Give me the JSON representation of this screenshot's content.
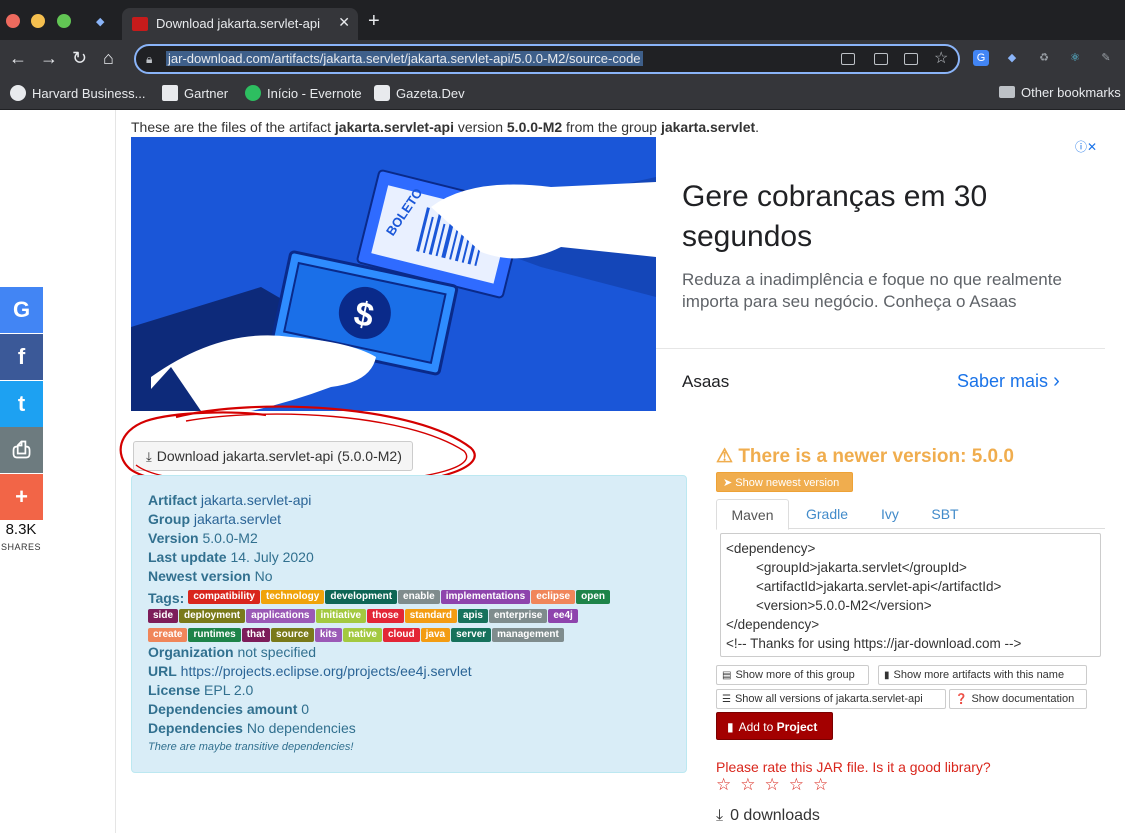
{
  "browser": {
    "tab_title": "Download jakarta.servlet-api",
    "tab_close": "✕",
    "new_tab": "+",
    "url": "jar-download.com/artifacts/jakarta.servlet/jakarta.servlet-api/5.0.0-M2/source-code",
    "bookmarks": [
      {
        "label": "Harvard Business...",
        "icon": "globe-icon"
      },
      {
        "label": "Gartner",
        "icon": "gartner-icon"
      },
      {
        "label": "Início - Evernote",
        "icon": "evernote-icon"
      },
      {
        "label": "Gazeta.Dev",
        "icon": "gazeta-icon"
      }
    ],
    "other_bookmarks": "Other bookmarks"
  },
  "share": {
    "count": "8.3K",
    "label": "SHARES",
    "buttons": [
      {
        "icon": "google-icon",
        "glyph": "G",
        "color": "#4285f4"
      },
      {
        "icon": "facebook-icon",
        "glyph": "f",
        "color": "#3b5998"
      },
      {
        "icon": "twitter-icon",
        "glyph": "t",
        "color": "#1da1f2"
      },
      {
        "icon": "print-icon",
        "glyph": "⎙",
        "color": "#6d7b7f"
      },
      {
        "icon": "plus-icon",
        "glyph": "+",
        "color": "#f26547"
      }
    ]
  },
  "intro": {
    "prefix": "These are the files of the artifact ",
    "artifact": "jakarta.servlet-api",
    "mid1": " version ",
    "version": "5.0.0-M2",
    "mid2": " from the group ",
    "group": "jakarta.servlet",
    "suffix": "."
  },
  "ad": {
    "headline": "Gere cobranças em 30 segundos",
    "body": "Reduza a inadimplência e foque no que realmente importa para seu negócio. Conheça o Asaas",
    "brand": "Asaas",
    "cta": "Saber mais",
    "ticket_text": "BOLETO",
    "info_icon": "ⓘ✕"
  },
  "download_button": "Download jakarta.servlet-api (5.0.0-M2)",
  "info": {
    "artifact": {
      "key": "Artifact",
      "value": "jakarta.servlet-api"
    },
    "group": {
      "key": "Group",
      "value": "jakarta.servlet"
    },
    "version": {
      "key": "Version",
      "value": "5.0.0-M2"
    },
    "last_update": {
      "key": "Last update",
      "value": "14. July 2020"
    },
    "newest_version": {
      "key": "Newest version",
      "value": "No"
    },
    "tags_key": "Tags:",
    "organization": {
      "key": "Organization",
      "value": "not specified"
    },
    "url": {
      "key": "URL",
      "value": "https://projects.eclipse.org/projects/ee4j.servlet"
    },
    "license": {
      "key": "License",
      "value": "EPL 2.0"
    },
    "dependencies_amount": {
      "key": "Dependencies amount",
      "value": "0"
    },
    "dependencies": {
      "key": "Dependencies",
      "value": "No dependencies"
    },
    "transitive_note": "There are maybe transitive dependencies!"
  },
  "tags": [
    [
      {
        "label": "compatibility",
        "color": "#d9261c"
      },
      {
        "label": "technology",
        "color": "#f0a30a"
      },
      {
        "label": "development",
        "color": "#0e6655"
      },
      {
        "label": "enable",
        "color": "#7f8c8d"
      },
      {
        "label": "implementations",
        "color": "#8e44ad"
      },
      {
        "label": "eclipse",
        "color": "#f0865a"
      },
      {
        "label": "open",
        "color": "#1e8449"
      }
    ],
    [
      {
        "label": "side",
        "color": "#7d1d5a"
      },
      {
        "label": "deployment",
        "color": "#7a7a1a"
      },
      {
        "label": "applications",
        "color": "#9b59b6"
      },
      {
        "label": "initiative",
        "color": "#a3c940"
      },
      {
        "label": "those",
        "color": "#e32636"
      },
      {
        "label": "standard",
        "color": "#f39c12"
      },
      {
        "label": "apis",
        "color": "#16725c"
      },
      {
        "label": "enterprise",
        "color": "#7f8c8d"
      },
      {
        "label": "ee4j",
        "color": "#8e44ad"
      }
    ],
    [
      {
        "label": "create",
        "color": "#f0865a"
      },
      {
        "label": "runtimes",
        "color": "#1e8449"
      },
      {
        "label": "that",
        "color": "#7d1d5a"
      },
      {
        "label": "source",
        "color": "#7a7a1a"
      },
      {
        "label": "kits",
        "color": "#9b59b6"
      },
      {
        "label": "native",
        "color": "#a3c940"
      },
      {
        "label": "cloud",
        "color": "#e32636"
      },
      {
        "label": "java",
        "color": "#f39c12"
      },
      {
        "label": "server",
        "color": "#16725c"
      },
      {
        "label": "management",
        "color": "#7f8c8d"
      }
    ]
  ],
  "right": {
    "newer_icon": "⚠",
    "newer_text": "There is a newer version: 5.0.0",
    "show_newest": "Show newest version",
    "tabs": [
      "Maven",
      "Gradle",
      "Ivy",
      "SBT"
    ],
    "code_lines": [
      "<dependency>",
      "        <groupId>jakarta.servlet</groupId>",
      "        <artifactId>jakarta.servlet-api</artifactId>",
      "        <version>5.0.0-M2</version>",
      "</dependency>",
      "<!-- Thanks for using https://jar-download.com -->"
    ],
    "btn_more_group": "Show more of this group",
    "btn_more_name": "Show more artifacts with this name",
    "btn_all_versions": "Show all versions of jakarta.servlet-api",
    "btn_documentation": "Show documentation",
    "add_prefix": "Add to ",
    "add_bold": "Project",
    "rate_text": "Please rate this JAR file. Is it a good library?",
    "stars": "☆☆☆☆☆",
    "downloads": "0 downloads"
  }
}
